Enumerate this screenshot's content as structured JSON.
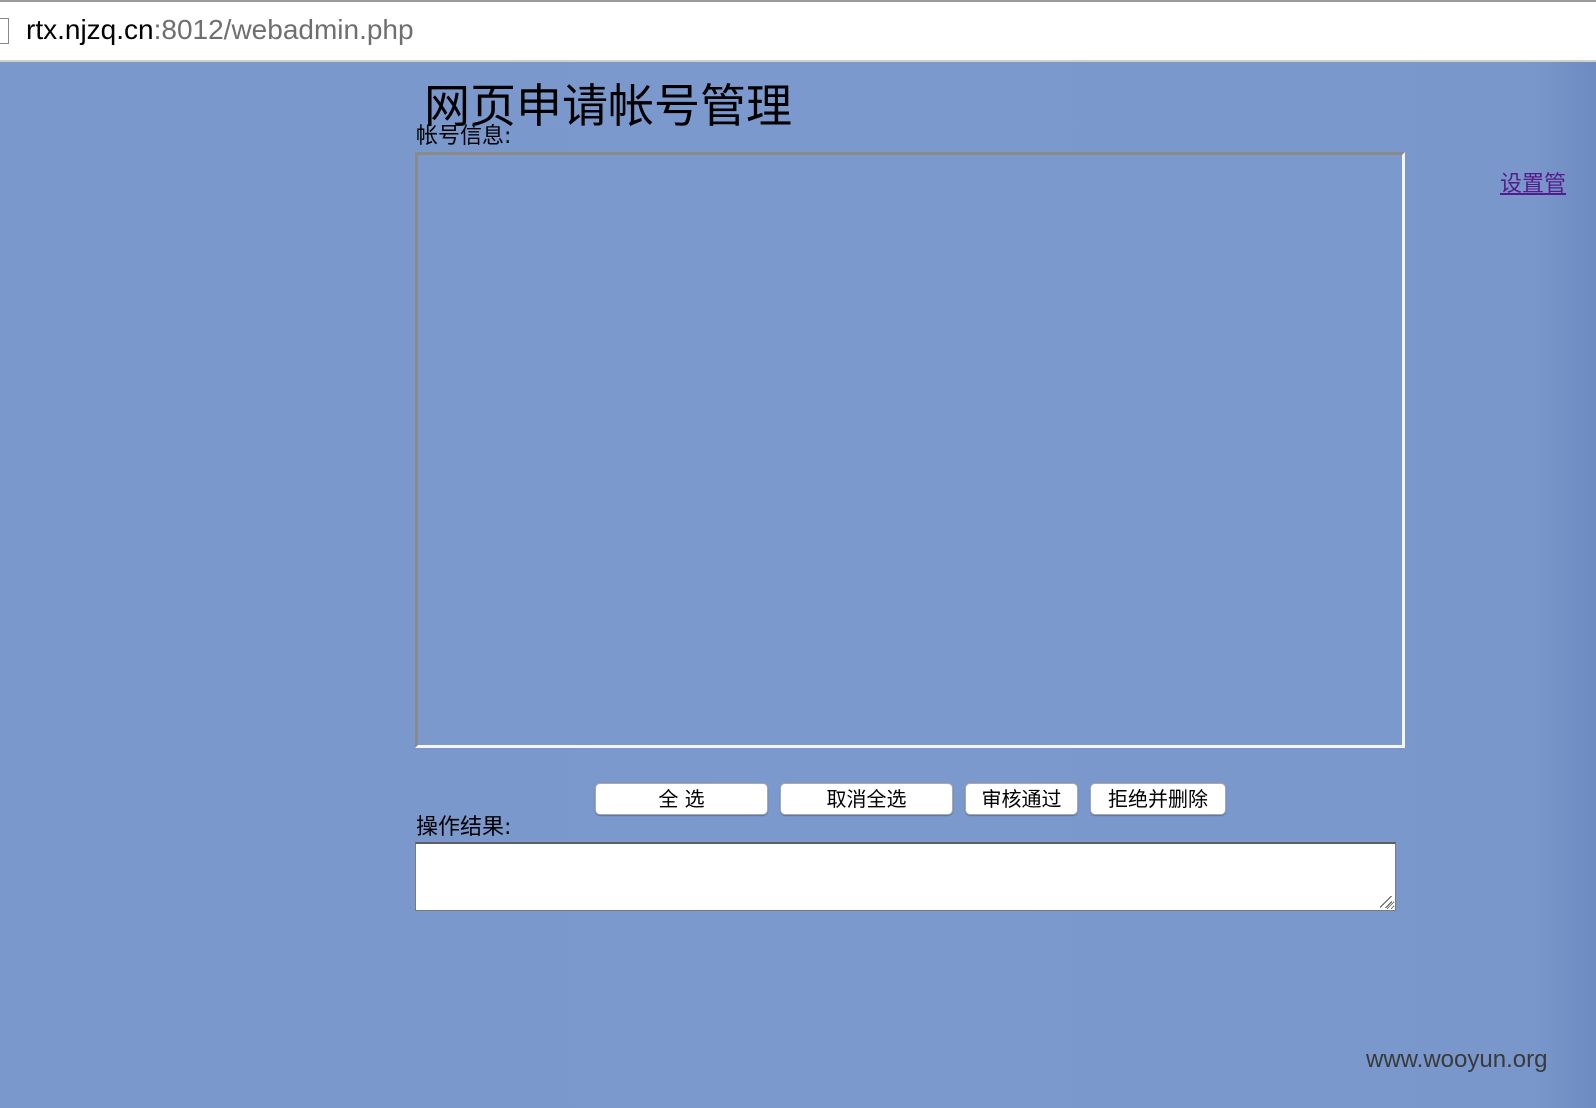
{
  "browser": {
    "url_host": "rtx.njzq.cn",
    "url_rest": ":8012/webadmin.php"
  },
  "page": {
    "title": "网页申请帐号管理",
    "info_label": "帐号信息:",
    "admin_link": "设置管",
    "result_label": "操作结果:",
    "result_value": ""
  },
  "buttons": {
    "select_all": "全 选",
    "deselect_all": "取消全选",
    "approve": "审核通过",
    "reject_delete": "拒绝并删除"
  },
  "watermark": "www.wooyun.org",
  "colors": {
    "page_background": "#7a98cc",
    "link": "#551a8b"
  }
}
